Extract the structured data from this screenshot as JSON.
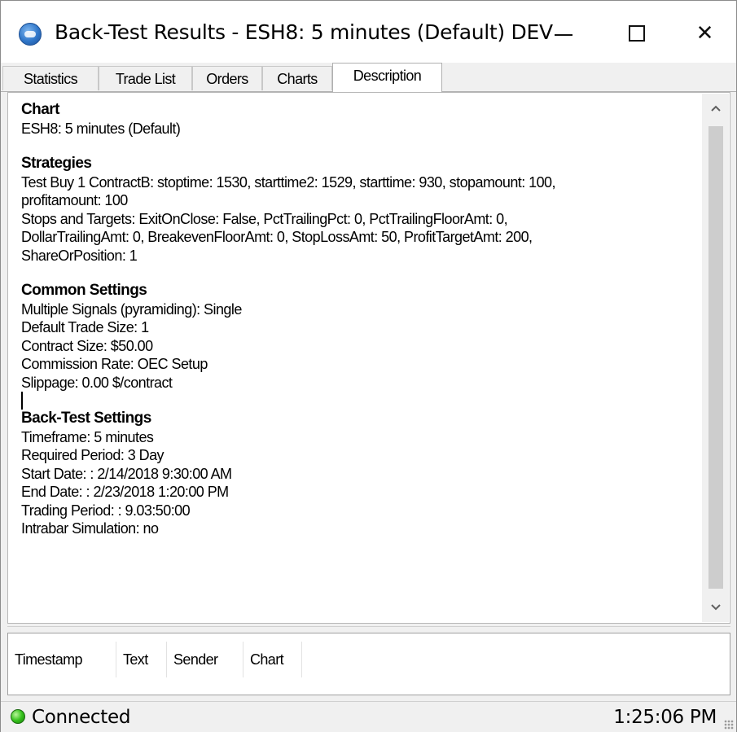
{
  "window": {
    "title": "Back-Test Results - ESH8: 5 minutes (Default) DEV",
    "close_glyph": "✕"
  },
  "tabs": [
    {
      "label": "Statistics"
    },
    {
      "label": "Trade List"
    },
    {
      "label": "Orders"
    },
    {
      "label": "Charts"
    },
    {
      "label": "Description",
      "active": true
    }
  ],
  "description": {
    "chart_heading": "Chart",
    "chart_line": "ESH8: 5 minutes (Default)",
    "strategies_heading": "Strategies",
    "strategies_lines": [
      "Test Buy 1 ContractB: stoptime: 1530, starttime2: 1529, starttime: 930, stopamount: 100,",
      "profitamount: 100",
      "Stops and Targets: ExitOnClose: False, PctTrailingPct: 0, PctTrailingFloorAmt: 0,",
      "DollarTrailingAmt: 0, BreakevenFloorAmt: 0, StopLossAmt: 50, ProfitTargetAmt: 200,",
      "ShareOrPosition: 1"
    ],
    "common_heading": "Common Settings",
    "common_lines": [
      "Multiple Signals (pyramiding): Single",
      "Default Trade Size: 1",
      "Contract Size: $50.00",
      "Commission Rate: OEC Setup",
      "Slippage: 0.00 $/contract"
    ],
    "backtest_heading": "Back-Test Settings",
    "backtest_lines": [
      "Timeframe: 5 minutes",
      "Required Period: 3 Day",
      "Start Date: : 2/14/2018 9:30:00 AM",
      "End Date: : 2/23/2018 1:20:00 PM",
      "Trading Period: : 9.03:50:00",
      "Intrabar Simulation: no"
    ]
  },
  "log_columns": [
    "Timestamp",
    "Text",
    "Sender",
    "Chart"
  ],
  "status": {
    "connection": "Connected",
    "time": "1:25:06 PM",
    "indicator_color": "#35c21c"
  },
  "icons": [
    "app-icon",
    "minimize-icon",
    "maximize-icon",
    "close-icon",
    "scroll-up-icon",
    "scroll-down-icon",
    "status-indicator-icon",
    "resize-grip-icon"
  ]
}
